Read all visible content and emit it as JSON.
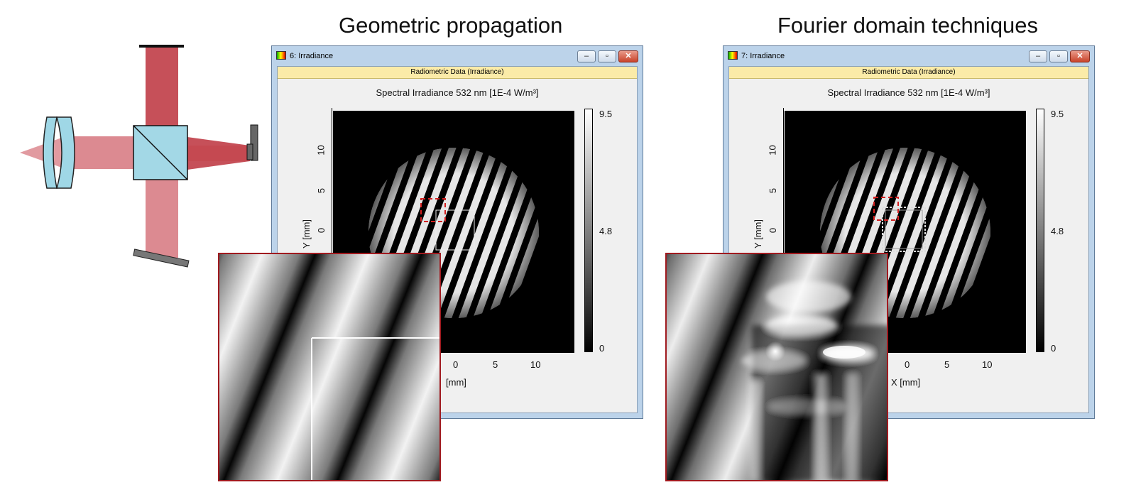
{
  "headings": {
    "left": "Geometric propagation",
    "right": "Fourier domain techniques"
  },
  "windows": [
    {
      "title": "6: Irradiance",
      "band": "Radiometric Data (Irradiance)",
      "plot_title": "Spectral Irradiance 532 nm  [1E-4 W/m³]",
      "colorbar": {
        "max": "9.5",
        "mid": "4.8",
        "min": "0"
      },
      "y_ticks": [
        "10",
        "5",
        "0"
      ],
      "x_ticks": [
        "0",
        "5",
        "10"
      ],
      "y_label": "Y [mm]",
      "x_label": "[mm]"
    },
    {
      "title": "7: Irradiance",
      "band": "Radiometric Data (Irradiance)",
      "plot_title": "Spectral Irradiance 532 nm  [1E-4 W/m³]",
      "colorbar": {
        "max": "9.5",
        "mid": "4.8",
        "min": "0"
      },
      "y_ticks": [
        "10",
        "5",
        "0"
      ],
      "x_ticks": [
        "0",
        "5",
        "10"
      ],
      "y_label": "Y [mm]",
      "x_label": "X [mm]"
    }
  ],
  "window_buttons": {
    "minimize": "–",
    "maximize": "▫",
    "close": "✕"
  },
  "colors": {
    "beam": "#d5767c",
    "beam_dark": "#c0454c",
    "lens": "#9fd7e6",
    "highlight_box": "#d42020",
    "zoom_border": "#a01a1f",
    "title_band": "#fbeba8"
  }
}
